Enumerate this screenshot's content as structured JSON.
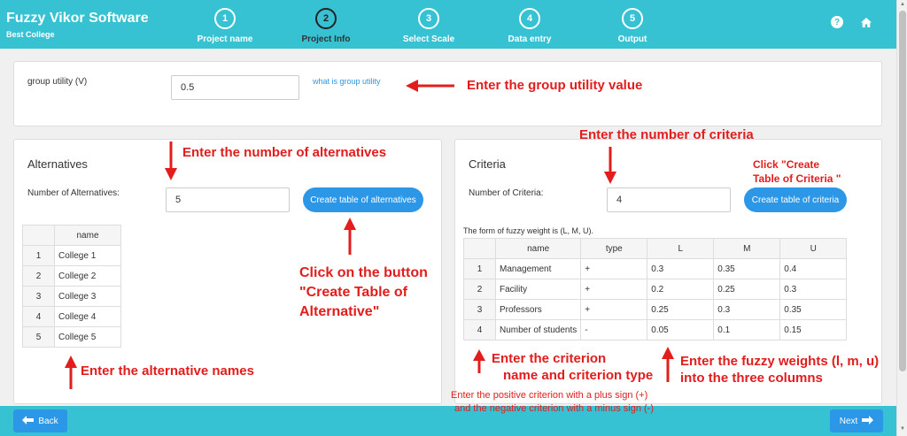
{
  "header": {
    "title": "Fuzzy Vikor Software",
    "subtitle": "Best College",
    "steps": [
      {
        "num": "1",
        "label": "Project name"
      },
      {
        "num": "2",
        "label": "Project Info"
      },
      {
        "num": "3",
        "label": "Select Scale"
      },
      {
        "num": "4",
        "label": "Data entry"
      },
      {
        "num": "5",
        "label": "Output"
      }
    ],
    "active_step": "2",
    "help_icon": "question-circle-icon",
    "home_icon": "home-icon"
  },
  "group_utility": {
    "label": "group utility (V)",
    "value": "0.5",
    "link": "what is group utility"
  },
  "alternatives": {
    "title": "Alternatives",
    "count_label": "Number of Alternatives:",
    "count_value": "5",
    "button": "Create table of alternatives",
    "table": {
      "header": "name",
      "rows": [
        {
          "num": "1",
          "name": "College 1"
        },
        {
          "num": "2",
          "name": "College 2"
        },
        {
          "num": "3",
          "name": "College 3"
        },
        {
          "num": "4",
          "name": "College 4"
        },
        {
          "num": "5",
          "name": "College 5"
        }
      ]
    }
  },
  "criteria": {
    "title": "Criteria",
    "count_label": "Number of Criteria:",
    "count_value": "4",
    "button": "Create table of criteria",
    "weight_note": "The form of fuzzy weight is (L, M, U).",
    "table": {
      "headers": {
        "name": "name",
        "type": "type",
        "l": "L",
        "m": "M",
        "u": "U"
      },
      "rows": [
        {
          "num": "1",
          "name": "Management",
          "type": "+",
          "l": "0.3",
          "m": "0.35",
          "u": "0.4"
        },
        {
          "num": "2",
          "name": "Facility",
          "type": "+",
          "l": "0.2",
          "m": "0.25",
          "u": "0.3"
        },
        {
          "num": "3",
          "name": "Professors",
          "type": "+",
          "l": "0.25",
          "m": "0.3",
          "u": "0.35"
        },
        {
          "num": "4",
          "name": "Number of students",
          "type": "-",
          "l": "0.05",
          "m": "0.1",
          "u": "0.15"
        }
      ]
    }
  },
  "footer": {
    "back": "Back",
    "next": "Next"
  },
  "annotations": {
    "group_utility": "Enter the group utility value",
    "num_alternatives": "Enter the number of alternatives",
    "num_criteria": "Enter the number of criteria",
    "click_create_criteria": [
      "Click \"Create",
      "Table of Criteria \""
    ],
    "click_create_alternative": [
      "Click on the button",
      "\"Create  Table of",
      "Alternative\""
    ],
    "alt_names": "Enter the alternative names",
    "criterion_name_type": [
      "Enter the criterion",
      "name and criterion type"
    ],
    "fuzzy_weights": [
      "Enter the fuzzy weights (l, m, u)",
      "into the three columns"
    ],
    "sign_note": [
      "Enter the positive criterion with a plus sign (+)",
      "and the negative criterion with a minus sign (-)"
    ]
  },
  "colors": {
    "header_bg": "#36c2d3",
    "button_blue": "#2b97e6",
    "annotation_red": "#e31c1c"
  }
}
